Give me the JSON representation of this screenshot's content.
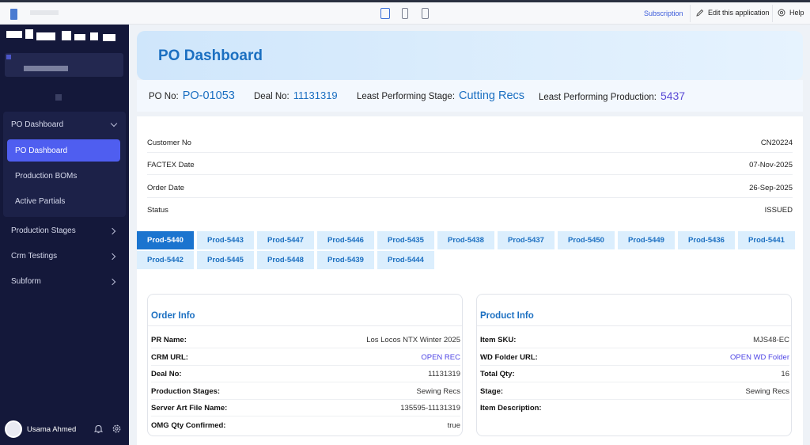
{
  "topbar": {
    "subscription": "Subscription",
    "edit_app": "Edit this application",
    "help": "Help"
  },
  "sidebar": {
    "group_title": "PO Dashboard",
    "group_items": [
      {
        "label": "PO Dashboard",
        "active": true
      },
      {
        "label": "Production BOMs",
        "active": false
      },
      {
        "label": "Active Partials",
        "active": false
      }
    ],
    "sections": [
      "Production Stages",
      "Crm Testings",
      "Subform"
    ],
    "user_name": "Usama Ahmed"
  },
  "page": {
    "title": "PO Dashboard",
    "kpis": {
      "po_label": "PO No:",
      "po_value": "PO-01053",
      "deal_label": "Deal No:",
      "deal_value": "11131319",
      "stage_label": "Least Performing Stage:",
      "stage_value": "Cutting Recs",
      "prod_label": "Least Performing Production:",
      "prod_value": "5437"
    },
    "details": [
      {
        "label": "Customer No",
        "value": "CN20224"
      },
      {
        "label": "FACTEX Date",
        "value": "07-Nov-2025"
      },
      {
        "label": "Order Date",
        "value": "26-Sep-2025"
      },
      {
        "label": "Status",
        "value": "ISSUED"
      }
    ],
    "tabs": [
      "Prod-5440",
      "Prod-5443",
      "Prod-5447",
      "Prod-5446",
      "Prod-5435",
      "Prod-5438",
      "Prod-5437",
      "Prod-5450",
      "Prod-5449",
      "Prod-5436",
      "Prod-5441",
      "Prod-5442",
      "Prod-5445",
      "Prod-5448",
      "Prod-5439",
      "Prod-5444"
    ],
    "active_tab": "Prod-5440",
    "order_info": {
      "title": "Order Info",
      "rows": [
        {
          "label": "PR Name:",
          "value": "Los Locos NTX Winter 2025"
        },
        {
          "label": "CRM URL:",
          "value": "OPEN REC",
          "link": true
        },
        {
          "label": "Deal No:",
          "value": "11131319"
        },
        {
          "label": "Production Stages:",
          "value": "Sewing Recs"
        },
        {
          "label": "Server Art File Name:",
          "value": "135595-11131319"
        },
        {
          "label": "OMG Qty Confirmed:",
          "value": "true"
        }
      ]
    },
    "product_info": {
      "title": "Product Info",
      "rows": [
        {
          "label": "Item SKU:",
          "value": "MJS48-EC"
        },
        {
          "label": "WD Folder URL:",
          "value": "OPEN WD Folder",
          "link": true
        },
        {
          "label": "Total Qty:",
          "value": "16"
        },
        {
          "label": "Stage:",
          "value": "Sewing Recs"
        },
        {
          "label": "Item Description:",
          "value": ""
        }
      ]
    }
  },
  "colors": {
    "sidebar_bg": "#14183a",
    "accent": "#1b6fc1",
    "active_nav": "#4f5ef0",
    "active_tab": "#1b74cf"
  }
}
